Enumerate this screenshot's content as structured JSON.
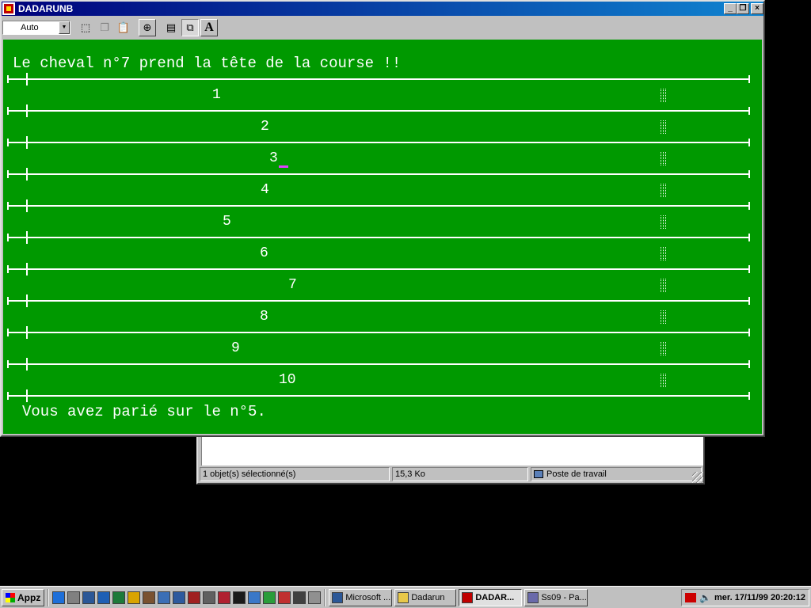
{
  "explorer": {
    "status_selected": "1 objet(s) sélectionné(s)",
    "status_size": "15,3 Ko",
    "status_location": "Poste de travail"
  },
  "dos_window": {
    "title": "DADARUNB",
    "font_size_value": "Auto",
    "toolbar_icons": [
      "mark-icon",
      "copy-icon",
      "paste-icon",
      "fullscreen-icon",
      "properties-icon",
      "background-icon",
      "font-icon"
    ],
    "console": {
      "top_message": "Le cheval n°7 prend la tête de la course !!",
      "bottom_message": "Vous avez parié sur le n°5.",
      "horses": [
        {
          "number": "1"
        },
        {
          "number": "2"
        },
        {
          "number": "3"
        },
        {
          "number": "4"
        },
        {
          "number": "5"
        },
        {
          "number": "6"
        },
        {
          "number": "7"
        },
        {
          "number": "8"
        },
        {
          "number": "9"
        },
        {
          "number": "10"
        }
      ],
      "colors": {
        "background": "#009900",
        "text": "#ffffff",
        "cursor": "#e040ff"
      }
    }
  },
  "taskbar": {
    "start_label": "Appz",
    "quicklaunch_icons": [
      "ie-icon",
      "desktop-icon",
      "script-icon",
      "word-icon",
      "excel-icon",
      "key-icon",
      "bank-icon",
      "notepad-icon",
      "plane-icon",
      "game-icon",
      "eraser-icon",
      "paint-icon",
      "app-icon",
      "network-icon",
      "globe-icon",
      "flag-icon",
      "shield-icon",
      "pen-icon"
    ],
    "tasks": [
      {
        "label": "Microsoft ...",
        "icon": "word-icon",
        "active": false
      },
      {
        "label": "Dadarun",
        "icon": "folder-icon",
        "active": false
      },
      {
        "label": "DADAR...",
        "icon": "dos-icon",
        "active": true
      },
      {
        "label": "Ss09 - Pa...",
        "icon": "paint-icon",
        "active": false
      }
    ],
    "clock": "mer. 17/11/99 20:20:12"
  }
}
